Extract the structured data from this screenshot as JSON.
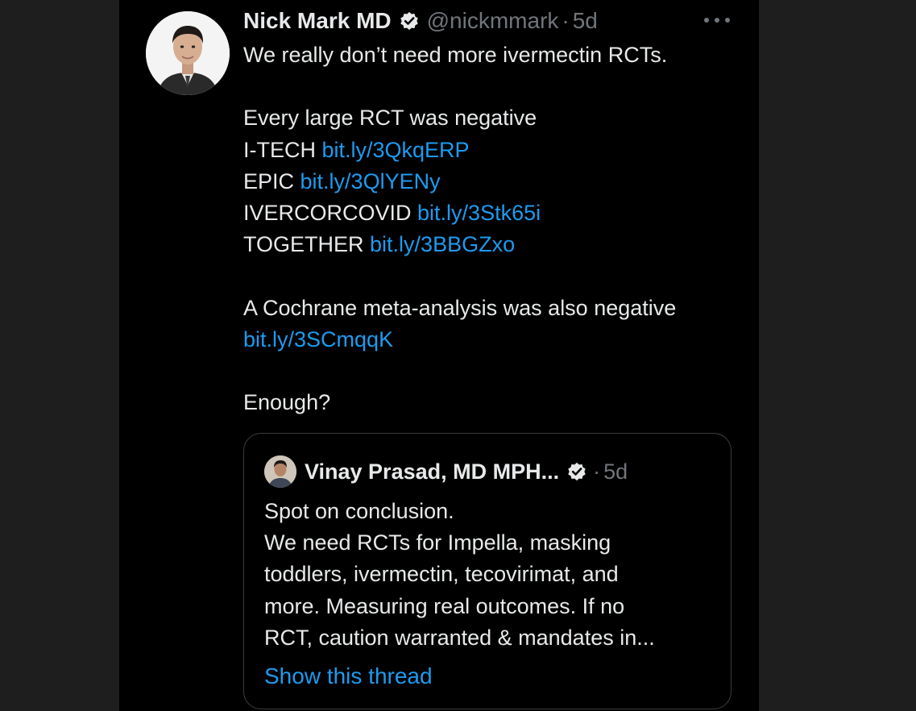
{
  "tweet": {
    "author_name": "Nick Mark MD",
    "handle": "@nickmmark",
    "separator": "·",
    "age": "5d",
    "lines": [
      {
        "text": "We really don’t need more ivermectin RCTs.",
        "link": ""
      },
      {
        "text": "",
        "link": ""
      },
      {
        "text": "Every large RCT was negative",
        "link": ""
      },
      {
        "text": "I-TECH ",
        "link": "bit.ly/3QkqERP"
      },
      {
        "text": "EPIC ",
        "link": "bit.ly/3QlYENy"
      },
      {
        "text": "IVERCORCOVID ",
        "link": "bit.ly/3Stk65i"
      },
      {
        "text": "TOGETHER ",
        "link": "bit.ly/3BBGZxo"
      },
      {
        "text": "",
        "link": ""
      },
      {
        "text": "A Cochrane meta-analysis was also negative",
        "link": ""
      },
      {
        "text": "",
        "link": "bit.ly/3SCmqqK"
      },
      {
        "text": "",
        "link": ""
      },
      {
        "text": "Enough?",
        "link": ""
      }
    ]
  },
  "quote": {
    "author_name": "Vinay Prasad, MD MPH...",
    "separator": "·",
    "age": "5d",
    "lines": [
      "Spot on conclusion.",
      "We need RCTs for Impella, masking",
      "toddlers, ivermectin, tecovirimat, and",
      "more. Measuring real outcomes. If no",
      "RCT, caution warranted & mandates in..."
    ],
    "show_thread": "Show this thread"
  },
  "icons": {
    "verified": "verified-badge-icon",
    "more": "more-horizontal-icon"
  },
  "colors": {
    "background": "#000000",
    "text": "#e7e9ea",
    "muted": "#71767b",
    "link": "#1d9bf0",
    "border": "#3a3d41"
  }
}
